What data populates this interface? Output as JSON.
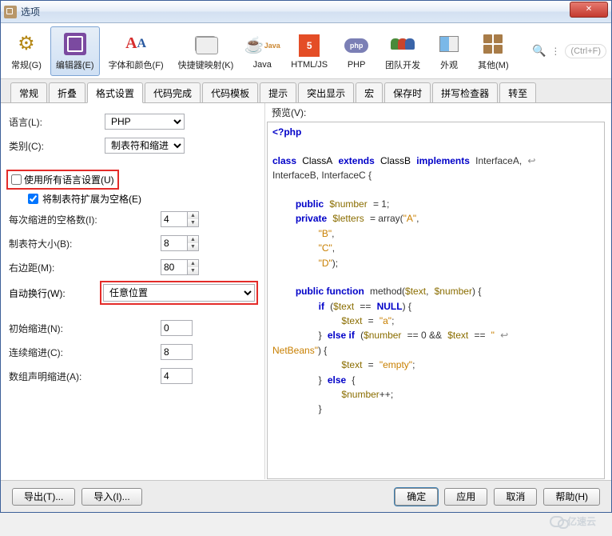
{
  "window": {
    "title": "选项"
  },
  "toolbar": {
    "general": "常规(G)",
    "editor": "编辑器(E)",
    "fonts": "字体和颜色(F)",
    "keymap": "快捷键映射(K)",
    "java": "Java",
    "htmljs": "HTML/JS",
    "php": "PHP",
    "team": "团队开发",
    "appearance": "外观",
    "other": "其他(M)",
    "search_hint": "(Ctrl+F)"
  },
  "tabs": [
    "常规",
    "折叠",
    "格式设置",
    "代码完成",
    "代码模板",
    "提示",
    "突出显示",
    "宏",
    "保存时",
    "拼写检查器",
    "转至"
  ],
  "active_tab_index": 2,
  "form": {
    "language_label": "语言(L):",
    "language_value": "PHP",
    "category_label": "类别(C):",
    "category_value": "制表符和缩进",
    "use_all_lang": "使用所有语言设置(U)",
    "use_all_lang_checked": false,
    "expand_tabs": "将制表符扩展为空格(E)",
    "expand_tabs_checked": true,
    "indent_spaces_label": "每次缩进的空格数(I):",
    "indent_spaces_value": "4",
    "tab_size_label": "制表符大小(B):",
    "tab_size_value": "8",
    "right_margin_label": "右边距(M):",
    "right_margin_value": "80",
    "wrap_label": "自动换行(W):",
    "wrap_value": "任意位置",
    "initial_indent_label": "初始缩进(N):",
    "initial_indent_value": "0",
    "cont_indent_label": "连续缩进(C):",
    "cont_indent_value": "8",
    "array_indent_label": "数组声明缩进(A):",
    "array_indent_value": "4"
  },
  "preview": {
    "label": "预览(V):"
  },
  "code": {
    "open": "<?php",
    "l1a": "class",
    "l1b": "ClassA",
    "l1c": "extends",
    "l1d": "ClassB",
    "l1e": "implements",
    "l1f": "InterfaceA,",
    "l2": "InterfaceB, InterfaceC {",
    "l3a": "public",
    "l3b": "$number",
    "l3c": "= 1;",
    "l4a": "private",
    "l4b": "$letters",
    "l4c": "= array(",
    "l4d": "\"A\"",
    "l4e": ",",
    "l5": "\"B\"",
    "l5e": ",",
    "l6": "\"C\"",
    "l6e": ",",
    "l7": "\"D\"",
    "l7e": ");",
    "l8a": "public function",
    "l8b": "method",
    "l8c": "(",
    "l8d": "$text",
    "l8e": ",",
    "l8f": "$number",
    "l8g": ") {",
    "l9a": "if",
    "l9b": "(",
    "l9c": "$text",
    "l9d": "==",
    "l9e": "NULL",
    "l9f": ") {",
    "l10a": "$text",
    "l10b": "=",
    "l10c": "\"a\"",
    "l10d": ";",
    "l11a": "}",
    "l11b": "else if",
    "l11c": "(",
    "l11d": "$number",
    "l11e": "== 0 &&",
    "l11f": "$text",
    "l11g": "==",
    "l11h": "\"",
    "l12": "NetBeans\"",
    "l12b": ") {",
    "l13a": "$text",
    "l13b": "=",
    "l13c": "\"empty\"",
    "l13d": ";",
    "l14a": "}",
    "l14b": "else",
    "l14c": "{",
    "l15a": "$number",
    "l15b": "++;",
    "l16": "}"
  },
  "footer": {
    "export": "导出(T)...",
    "import": "导入(I)...",
    "ok": "确定",
    "apply": "应用",
    "cancel": "取消",
    "help": "帮助(H)"
  },
  "watermark": "亿速云"
}
